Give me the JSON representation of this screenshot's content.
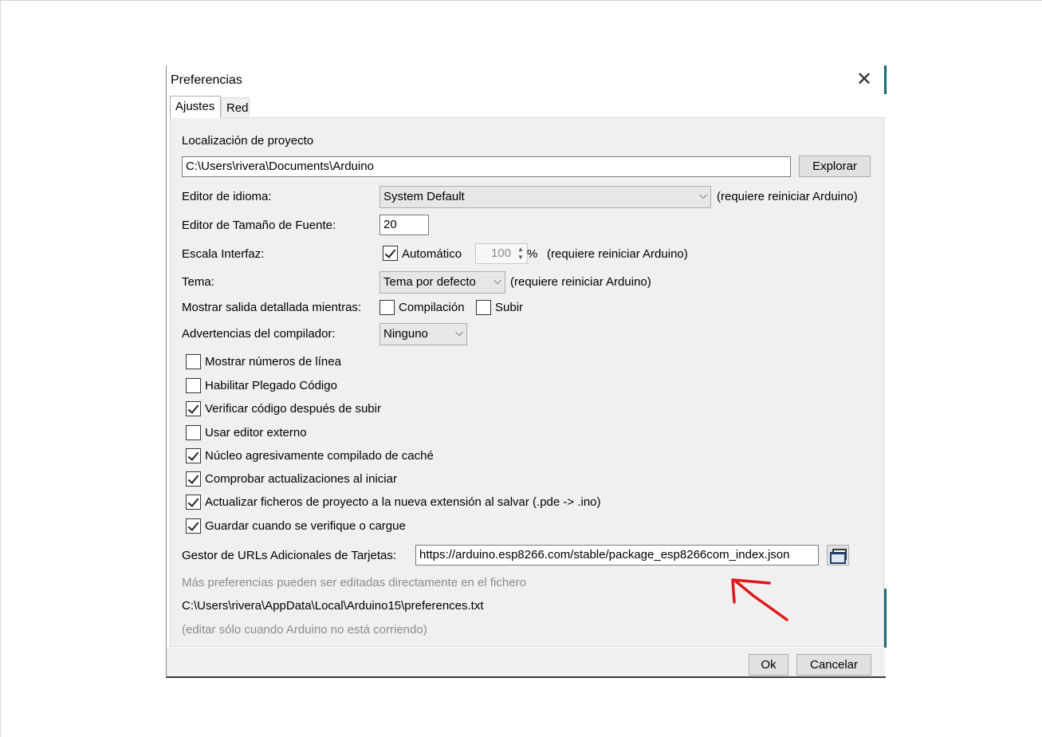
{
  "dialog": {
    "title": "Preferencias",
    "close_glyph": "✕",
    "tabs": [
      {
        "label": "Ajustes",
        "active": true
      },
      {
        "label": "Red",
        "active": false
      }
    ]
  },
  "settings": {
    "project_location_label": "Localización de proyecto",
    "project_location_value": "C:\\Users\\rivera\\Documents\\Arduino",
    "browse_button": "Explorar",
    "language_label": "Editor de idioma:",
    "language_value": "System Default",
    "language_note": "(requiere reiniciar Arduino)",
    "font_size_label": "Editor de Tamaño de Fuente:",
    "font_size_value": "20",
    "scale_label": "Escala Interfaz:",
    "scale_auto_label": "Automático",
    "scale_auto_checked": true,
    "scale_value": "100",
    "scale_unit": "%",
    "scale_note": "(requiere reiniciar Arduino)",
    "theme_label": "Tema:",
    "theme_value": "Tema por defecto",
    "theme_note": "(requiere reiniciar Arduino)",
    "verbose_label": "Mostrar salida detallada mientras:",
    "verbose_compile_label": "Compilación",
    "verbose_compile_checked": false,
    "verbose_upload_label": "Subir",
    "verbose_upload_checked": false,
    "warnings_label": "Advertencias del compilador:",
    "warnings_value": "Ninguno",
    "options": [
      {
        "label": "Mostrar números de línea",
        "checked": false
      },
      {
        "label": "Habilitar Plegado Código",
        "checked": false
      },
      {
        "label": "Verificar código después de subir",
        "checked": true
      },
      {
        "label": "Usar editor externo",
        "checked": false
      },
      {
        "label": "Núcleo agresivamente compilado de caché",
        "checked": true
      },
      {
        "label": "Comprobar actualizaciones al iniciar",
        "checked": true
      },
      {
        "label": "Actualizar ficheros de proyecto a la nueva extensión al salvar (.pde -> .ino)",
        "checked": true
      },
      {
        "label": "Guardar cuando se verifique o cargue",
        "checked": true
      }
    ],
    "board_urls_label": "Gestor de URLs Adicionales de Tarjetas:",
    "board_urls_value": "https://arduino.esp8266.com/stable/package_esp8266com_index.json",
    "more_prefs_text": "Más preferencias pueden ser editadas directamente en el fichero",
    "prefs_file_path": "C:\\Users\\rivera\\AppData\\Local\\Arduino15\\preferences.txt",
    "edit_note": "(editar sólo cuando Arduino no está corriendo)"
  },
  "footer": {
    "ok_button": "Ok",
    "cancel_button": "Cancelar"
  },
  "colors": {
    "annotation_arrow": "#e01818",
    "window_accent": "#1a6b6f"
  }
}
